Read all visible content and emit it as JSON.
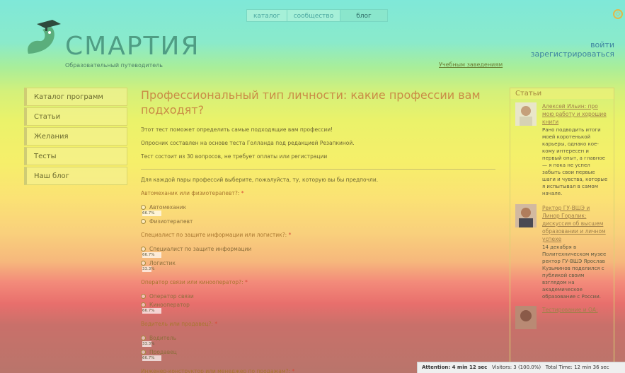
{
  "topnav": {
    "tabs": [
      "каталог",
      "сообщество",
      "блог"
    ]
  },
  "header": {
    "logo_text": "СМАРТИЯ",
    "tagline": "Образовательный путеводитель",
    "schools_link": "Учебным заведениям",
    "login": "войти",
    "register": "зарегистрироваться"
  },
  "sidebar": {
    "items": [
      "Каталог программ",
      "Статьи",
      "Желания",
      "Тесты",
      "Наш блог"
    ]
  },
  "main": {
    "title": "Профессиональный тип личности: какие профессии вам подходят?",
    "intro": [
      "Этот тест поможет определить самые подходящие вам профессии!",
      "Опросник составлен на основе теста Голланда под редакцией Резапкиной.",
      "Тест состоит из 30 вопросов, не требует оплаты или регистрации"
    ],
    "instruction": "Для каждой пары профессий выберите, пожалуйста, ту, которую вы бы предпочли.",
    "questions": [
      {
        "text": "Автомеханик или физиотерапевт?:",
        "req": "*",
        "options": [
          {
            "label": "Автомеханик",
            "pct": "66.7%"
          },
          {
            "label": "Физиотерапевт",
            "pct": ""
          }
        ]
      },
      {
        "text": "Специалист по защите информации или логистик?:",
        "req": "*",
        "options": [
          {
            "label": "Специалист по защите информации",
            "pct": "66.7%"
          },
          {
            "label": "Логистик",
            "pct": "33.3%"
          }
        ]
      },
      {
        "text": "Оператор связи или кинооператор?:",
        "req": "*",
        "options": [
          {
            "label": "Оператор связи",
            "pct": ""
          },
          {
            "label": "Кинооператор",
            "pct": "66.7%"
          }
        ]
      },
      {
        "text": "Водитель или продавец?:",
        "req": "*",
        "options": [
          {
            "label": "Водитель",
            "pct": "33.3%"
          },
          {
            "label": "Продавец",
            "pct": "66.7%"
          }
        ]
      },
      {
        "text": "Инженер-конструктор или менеджер по продажам?:",
        "req": "*",
        "options": []
      }
    ]
  },
  "articles": {
    "header": "Статьи",
    "items": [
      {
        "title": "Алексей Ильин: про мою работу и хорошие книги",
        "desc": "Рано подводить итоги моей коротенькой карьеры, однако кое-кому интересен и первый опыт, а главное — я пока не успел забыть свои первые шаги и чувства, которые я испытывал в самом начале."
      },
      {
        "title": "Ректор ГУ-ВШЭ и Линор Горалик: дискуссия об высшем образовании и личном успехе",
        "desc": "14 декабря в Политехническом музее ректор ГУ-ВШЭ Ярослав Кузьминов поделился с публикой своим взглядом на академическое образование с России."
      },
      {
        "title": "Тестирование и ОА:",
        "desc": ""
      }
    ]
  },
  "statusbar": {
    "attention": "Attention: 4 min 12 sec",
    "visitors": "Visitors: 3 (100.0%)",
    "total": "Total Time: 12 min 36 sec"
  },
  "colors": {
    "accent": "#c98c46",
    "link": "#3d84a0",
    "required": "#d84b3a"
  }
}
